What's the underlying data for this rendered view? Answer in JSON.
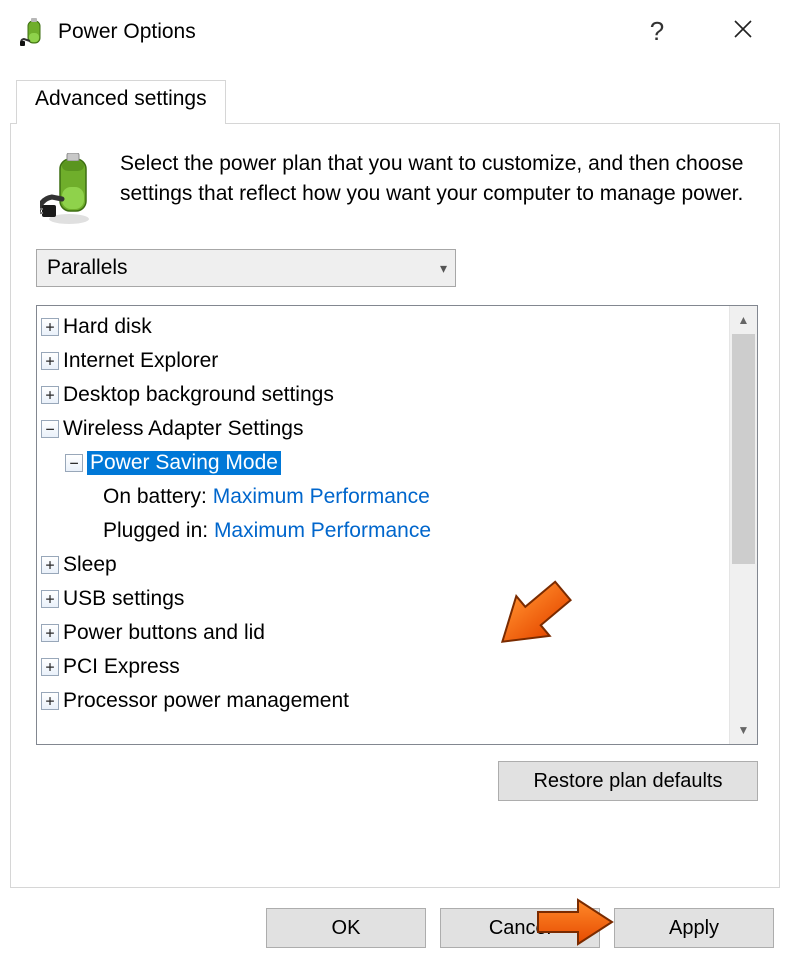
{
  "title": "Power Options",
  "tab_label": "Advanced settings",
  "description": "Select the power plan that you want to customize, and then choose settings that reflect how you want your computer to manage power.",
  "plan_dropdown": {
    "selected": "Parallels"
  },
  "tree": {
    "hard_disk": "Hard disk",
    "internet_explorer": "Internet Explorer",
    "desktop_bg": "Desktop background settings",
    "wireless": "Wireless Adapter Settings",
    "power_saving_mode": "Power Saving Mode",
    "on_battery_label": "On battery:",
    "on_battery_value": "Maximum Performance",
    "plugged_in_label": "Plugged in:",
    "plugged_in_value": "Maximum Performance",
    "sleep": "Sleep",
    "usb": "USB settings",
    "power_buttons": "Power buttons and lid",
    "pci": "PCI Express",
    "processor": "Processor power management"
  },
  "buttons": {
    "restore": "Restore plan defaults",
    "ok": "OK",
    "cancel": "Cancel",
    "apply": "Apply"
  },
  "glyphs": {
    "chev_down": "▾",
    "sb_up": "▲",
    "sb_down": "▼"
  }
}
